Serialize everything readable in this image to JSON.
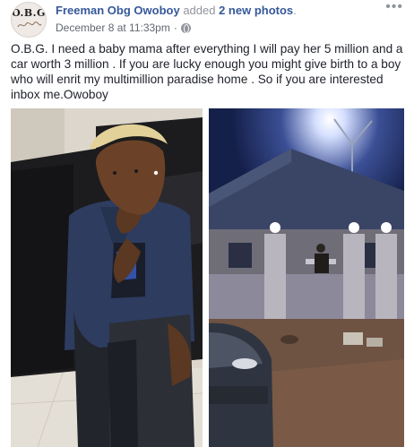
{
  "post": {
    "avatar_text": "O.B.G",
    "author": "Freeman Obg Owoboy",
    "action_prefix": "added",
    "action_count": "2 new photos",
    "action_suffix": ".",
    "timestamp": "December 8 at 11:33pm",
    "separator": "·",
    "privacy_icon": "globe-icon",
    "more_label": "•••",
    "body": "O.B.G. I need a baby mama after everything I will pay her 5 million and a car worth 3 million . If you are lucky enough you might give birth to a boy who will enrit my multimillion paradise home . So if you are interested inbox me.Owoboy"
  },
  "photos": [
    {
      "subject": "man-on-sofa-photo"
    },
    {
      "subject": "house-at-night-photo"
    }
  ],
  "colors": {
    "link": "#365899",
    "muted": "#90949c",
    "text": "#1d2129"
  }
}
